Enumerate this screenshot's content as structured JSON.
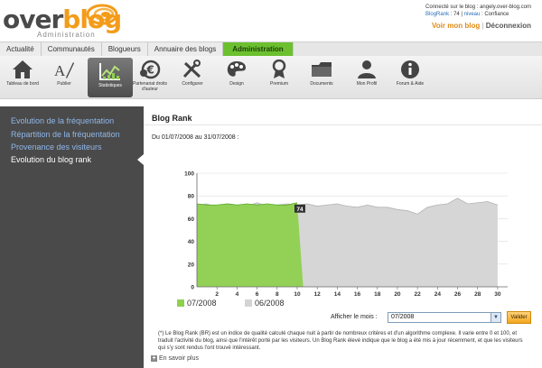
{
  "header": {
    "logo_main": "over",
    "logo_accent": "blog",
    "logo_sub": "Administration",
    "connected_text": "Connecté sur le blog : angely.over-blog.com",
    "blogrank_label": "BlogRank",
    "blogrank_value": ": 74",
    "level_label": "niveau",
    "level_value": ": Confiance",
    "my_blog": "Voir mon blog",
    "separator": "|",
    "logout": "Déconnexion"
  },
  "tabs": [
    "Actualité",
    "Communautés",
    "Blogueurs",
    "Annuaire des blogs",
    "Administration"
  ],
  "toolbar": [
    {
      "label": "Tableau de bord",
      "icon": "house-icon"
    },
    {
      "label": "Publier",
      "icon": "publish-pen-icon"
    },
    {
      "label": "Statistiques",
      "icon": "statistics-chart-icon"
    },
    {
      "label": "Partenariat droits d'auteur",
      "icon": "euro-coin-icon"
    },
    {
      "label": "Configurer",
      "icon": "tools-icon"
    },
    {
      "label": "Design",
      "icon": "palette-icon"
    },
    {
      "label": "Premium",
      "icon": "medal-icon"
    },
    {
      "label": "Documents",
      "icon": "folder-icon"
    },
    {
      "label": "Mon Profil",
      "icon": "user-silhouette-icon"
    },
    {
      "label": "Forum & Aide",
      "icon": "info-icon"
    }
  ],
  "sidebar": {
    "items": [
      {
        "label": "Evolution de la fréquentation"
      },
      {
        "label": "Répartition de la fréquentation"
      },
      {
        "label": "Provenance des visiteurs"
      },
      {
        "label": "Evolution du blog rank"
      }
    ]
  },
  "main": {
    "title": "Blog Rank",
    "date_range": "Du 01/07/2008 au 31/07/2008 :",
    "month_label": "Afficher le mois :",
    "month_value": "07/2008",
    "validate": "Valider",
    "info": "(*) Le Blog Rank (BR) est un indice de qualité calculé chaque nuit à partir de nombreux critères et d'un algorithme complexe. Il varie entre 0 et 100, et traduit l'activité du blog, ainsi que l'intérêt porté par les visiteurs. Un Blog Rank élevé indique que le blog a été mis à jour récemment, et que les visiteurs qui s'y sont rendus l'ont trouvé intéressant.",
    "more": "En savoir plus"
  },
  "chart_data": {
    "type": "area",
    "ylim": [
      0,
      100
    ],
    "yticks": [
      0,
      20,
      40,
      60,
      80,
      100
    ],
    "xlim": [
      0,
      31
    ],
    "xticks": [
      2,
      4,
      6,
      8,
      10,
      12,
      14,
      16,
      18,
      20,
      22,
      24,
      26,
      28,
      30
    ],
    "annotation": "74",
    "annotation_x": 10,
    "annotation_y": 74,
    "legend_position": "bottom",
    "series": [
      {
        "name": "07/2008",
        "color": "#8fd14f",
        "x": [
          0,
          1,
          2,
          3,
          4,
          5,
          6,
          7,
          8,
          9,
          10
        ],
        "values": [
          73,
          72,
          72,
          73,
          72,
          73,
          72,
          73,
          72,
          72,
          74
        ]
      },
      {
        "name": "06/2008",
        "color": "#d4d4d4",
        "x": [
          0,
          1,
          2,
          3,
          4,
          5,
          6,
          7,
          8,
          9,
          10,
          11,
          12,
          13,
          14,
          15,
          16,
          17,
          18,
          19,
          20,
          21,
          22,
          23,
          24,
          25,
          26,
          27,
          28,
          29,
          30
        ],
        "values": [
          72,
          73,
          70,
          73,
          72,
          71,
          74,
          71,
          72,
          73,
          72,
          73,
          71,
          72,
          73,
          71,
          70,
          72,
          70,
          70,
          68,
          67,
          64,
          70,
          72,
          73,
          78,
          73,
          74,
          75,
          72
        ]
      }
    ]
  }
}
